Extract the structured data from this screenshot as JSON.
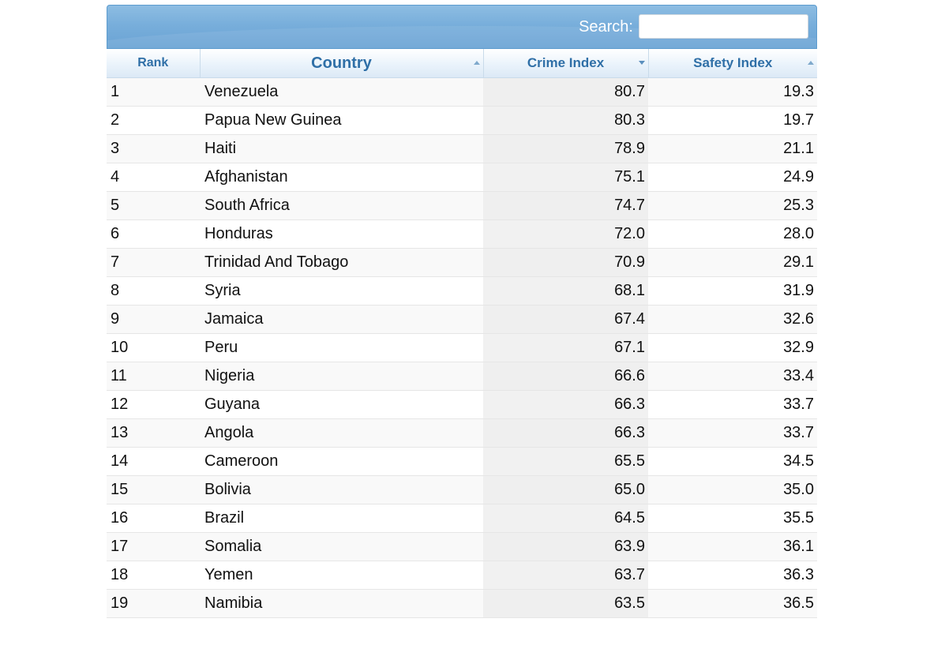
{
  "search": {
    "label": "Search:",
    "value": "",
    "placeholder": ""
  },
  "table": {
    "headers": {
      "rank": "Rank",
      "country": "Country",
      "crime": "Crime Index",
      "safety": "Safety Index"
    },
    "rows": [
      {
        "rank": "1",
        "country": "Venezuela",
        "crime": "80.7",
        "safety": "19.3"
      },
      {
        "rank": "2",
        "country": "Papua New Guinea",
        "crime": "80.3",
        "safety": "19.7"
      },
      {
        "rank": "3",
        "country": "Haiti",
        "crime": "78.9",
        "safety": "21.1"
      },
      {
        "rank": "4",
        "country": "Afghanistan",
        "crime": "75.1",
        "safety": "24.9"
      },
      {
        "rank": "5",
        "country": "South Africa",
        "crime": "74.7",
        "safety": "25.3"
      },
      {
        "rank": "6",
        "country": "Honduras",
        "crime": "72.0",
        "safety": "28.0"
      },
      {
        "rank": "7",
        "country": "Trinidad And Tobago",
        "crime": "70.9",
        "safety": "29.1"
      },
      {
        "rank": "8",
        "country": "Syria",
        "crime": "68.1",
        "safety": "31.9"
      },
      {
        "rank": "9",
        "country": "Jamaica",
        "crime": "67.4",
        "safety": "32.6"
      },
      {
        "rank": "10",
        "country": "Peru",
        "crime": "67.1",
        "safety": "32.9"
      },
      {
        "rank": "11",
        "country": "Nigeria",
        "crime": "66.6",
        "safety": "33.4"
      },
      {
        "rank": "12",
        "country": "Guyana",
        "crime": "66.3",
        "safety": "33.7"
      },
      {
        "rank": "13",
        "country": "Angola",
        "crime": "66.3",
        "safety": "33.7"
      },
      {
        "rank": "14",
        "country": "Cameroon",
        "crime": "65.5",
        "safety": "34.5"
      },
      {
        "rank": "15",
        "country": "Bolivia",
        "crime": "65.0",
        "safety": "35.0"
      },
      {
        "rank": "16",
        "country": "Brazil",
        "crime": "64.5",
        "safety": "35.5"
      },
      {
        "rank": "17",
        "country": "Somalia",
        "crime": "63.9",
        "safety": "36.1"
      },
      {
        "rank": "18",
        "country": "Yemen",
        "crime": "63.7",
        "safety": "36.3"
      },
      {
        "rank": "19",
        "country": "Namibia",
        "crime": "63.5",
        "safety": "36.5"
      }
    ]
  }
}
